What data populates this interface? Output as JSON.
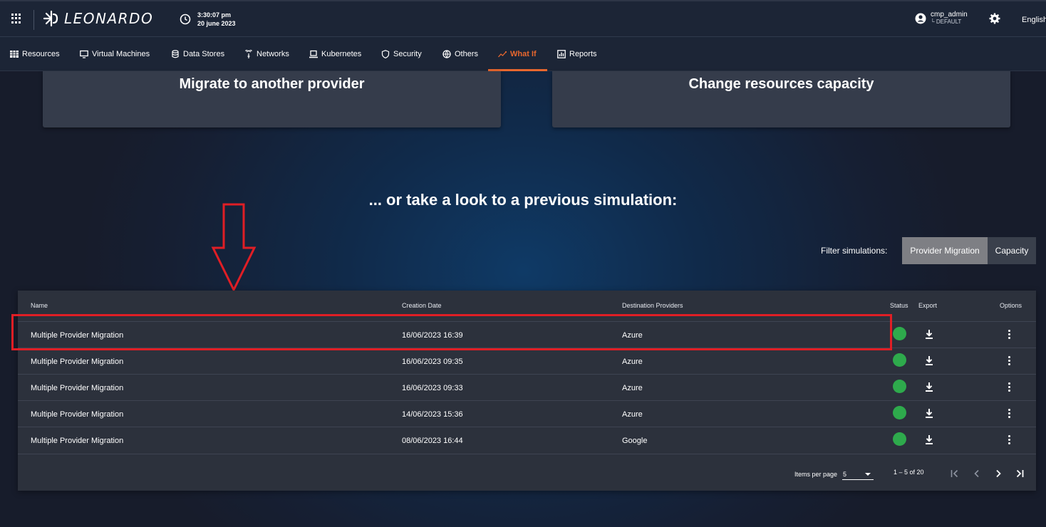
{
  "header": {
    "brand": "LEONARDO",
    "time": "3:30:07 pm",
    "date": "20 june 2023",
    "user_name": "cmp_admin",
    "user_tenant": "└ DEFAULT",
    "language": "English"
  },
  "nav": {
    "items": [
      {
        "label": "Resources",
        "icon": "grid-icon"
      },
      {
        "label": "Virtual Machines",
        "icon": "monitor-icon"
      },
      {
        "label": "Data Stores",
        "icon": "database-icon"
      },
      {
        "label": "Networks",
        "icon": "antenna-icon"
      },
      {
        "label": "Kubernetes",
        "icon": "laptop-icon"
      },
      {
        "label": "Security",
        "icon": "shield-icon"
      },
      {
        "label": "Others",
        "icon": "globe-icon"
      },
      {
        "label": "What If",
        "icon": "trend-icon",
        "active": true
      },
      {
        "label": "Reports",
        "icon": "report-icon"
      }
    ]
  },
  "cards": {
    "migrate": "Migrate to another provider",
    "capacity": "Change resources capacity"
  },
  "headline": "... or take a look to a previous simulation:",
  "filter": {
    "label": "Filter simulations:",
    "options": [
      "Provider Migration",
      "Capacity"
    ],
    "selected": "Provider Migration"
  },
  "table": {
    "columns": {
      "name": "Name",
      "creation_date": "Creation Date",
      "destination": "Destination Providers",
      "status": "Status",
      "export": "Export",
      "options": "Options"
    },
    "rows": [
      {
        "name": "Multiple Provider Migration",
        "date": "16/06/2023 16:39",
        "provider": "Azure",
        "status": "ok"
      },
      {
        "name": "Multiple Provider Migration",
        "date": "16/06/2023 09:35",
        "provider": "Azure",
        "status": "ok"
      },
      {
        "name": "Multiple Provider Migration",
        "date": "16/06/2023 09:33",
        "provider": "Azure",
        "status": "ok"
      },
      {
        "name": "Multiple Provider Migration",
        "date": "14/06/2023 15:36",
        "provider": "Azure",
        "status": "ok"
      },
      {
        "name": "Multiple Provider Migration",
        "date": "08/06/2023 16:44",
        "provider": "Google",
        "status": "ok"
      }
    ],
    "paginator": {
      "items_per_page_label": "Items per page",
      "items_per_page": "5",
      "range": "1 – 5 of 20"
    }
  },
  "colors": {
    "accent": "#e8672e",
    "status_ok": "#2eaa4c",
    "highlight": "#e01e25"
  }
}
